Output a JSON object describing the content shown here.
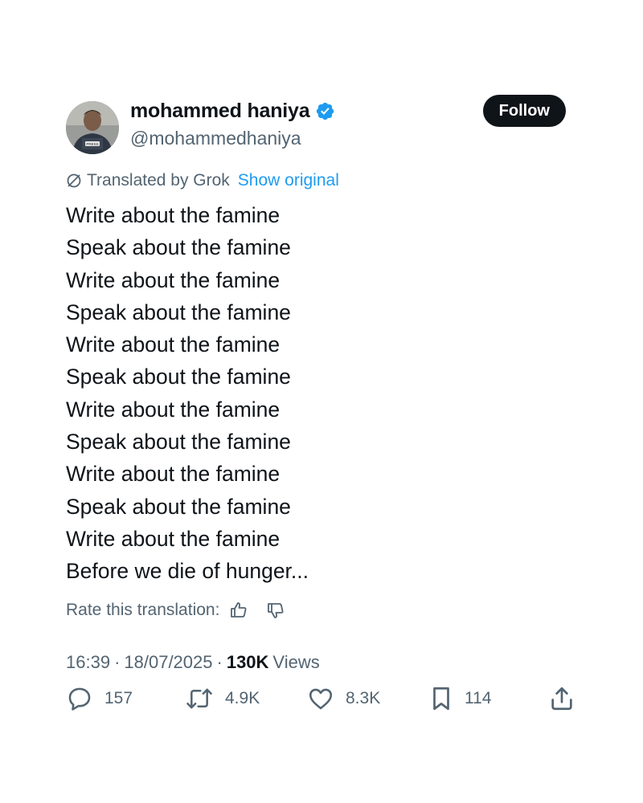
{
  "author": {
    "display_name": "mohammed haniya",
    "handle": "@mohammedhaniya",
    "verified": true,
    "avatar_badge_text": "PRESS"
  },
  "follow_label": "Follow",
  "translation": {
    "label": "Translated by Grok",
    "show_original_label": "Show original",
    "rate_label": "Rate this translation:"
  },
  "body_lines": [
    "Write about the famine",
    "Speak about the famine",
    "Write about the famine",
    "Speak about the famine",
    "Write about the famine",
    "Speak about the famine",
    "Write about the famine",
    "Speak about the famine",
    "Write about the famine",
    "Speak about the famine",
    "Write about the famine",
    "Before we die of hunger..."
  ],
  "meta": {
    "time": "16:39",
    "separator": "·",
    "date": "18/07/2025",
    "views_count": "130K",
    "views_label": "Views"
  },
  "actions": {
    "replies": "157",
    "reposts": "4.9K",
    "likes": "8.3K",
    "bookmarks": "114"
  },
  "colors": {
    "text": "#0f1419",
    "secondary": "#536471",
    "accent": "#1d9bf0",
    "follow_bg": "#0f1419"
  },
  "icons": {
    "verified": "verified-badge-icon",
    "grok": "grok-translate-icon",
    "thumb_up": "thumbs-up-icon",
    "thumb_down": "thumbs-down-icon",
    "reply": "reply-bubble-icon",
    "repost": "repost-icon",
    "like": "heart-icon",
    "bookmark": "bookmark-icon",
    "share": "share-icon"
  }
}
